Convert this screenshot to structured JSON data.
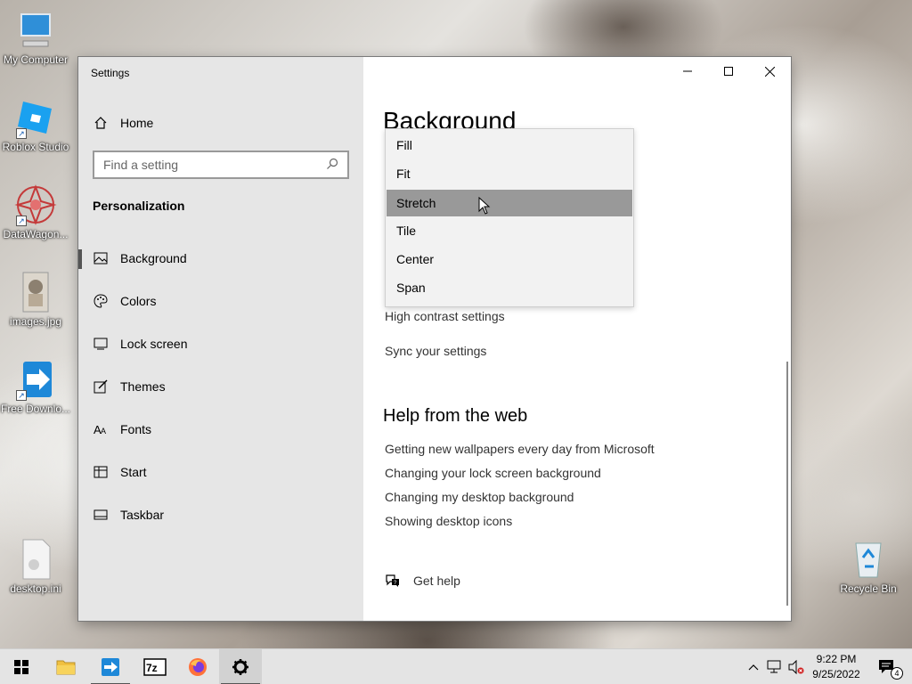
{
  "desktop": {
    "icons": [
      {
        "label": "My Computer"
      },
      {
        "label": "Roblox Studio"
      },
      {
        "label": "DataWagon..."
      },
      {
        "label": "images.jpg"
      },
      {
        "label": "Free Downlo..."
      },
      {
        "label": "desktop.ini"
      },
      {
        "label": "Recycle Bin"
      }
    ]
  },
  "window": {
    "title": "Settings",
    "sidebar": {
      "home": "Home",
      "search_placeholder": "Find a setting",
      "section": "Personalization",
      "items": [
        {
          "label": "Background"
        },
        {
          "label": "Colors"
        },
        {
          "label": "Lock screen"
        },
        {
          "label": "Themes"
        },
        {
          "label": "Fonts"
        },
        {
          "label": "Start"
        },
        {
          "label": "Taskbar"
        }
      ]
    },
    "content": {
      "title": "Background",
      "links": [
        {
          "label": "High contrast settings"
        },
        {
          "label": "Sync your settings"
        }
      ],
      "help_heading": "Help from the web",
      "help_links": [
        {
          "label": "Getting new wallpapers every day from Microsoft"
        },
        {
          "label": "Changing your lock screen background"
        },
        {
          "label": "Changing my desktop background"
        },
        {
          "label": "Showing desktop icons"
        }
      ],
      "get_help": "Get help"
    },
    "dropdown": {
      "options": [
        "Fill",
        "Fit",
        "Stretch",
        "Tile",
        "Center",
        "Span"
      ],
      "hovered": "Stretch"
    }
  },
  "taskbar": {
    "time": "9:22 PM",
    "date": "9/25/2022",
    "notification_count": "4"
  }
}
